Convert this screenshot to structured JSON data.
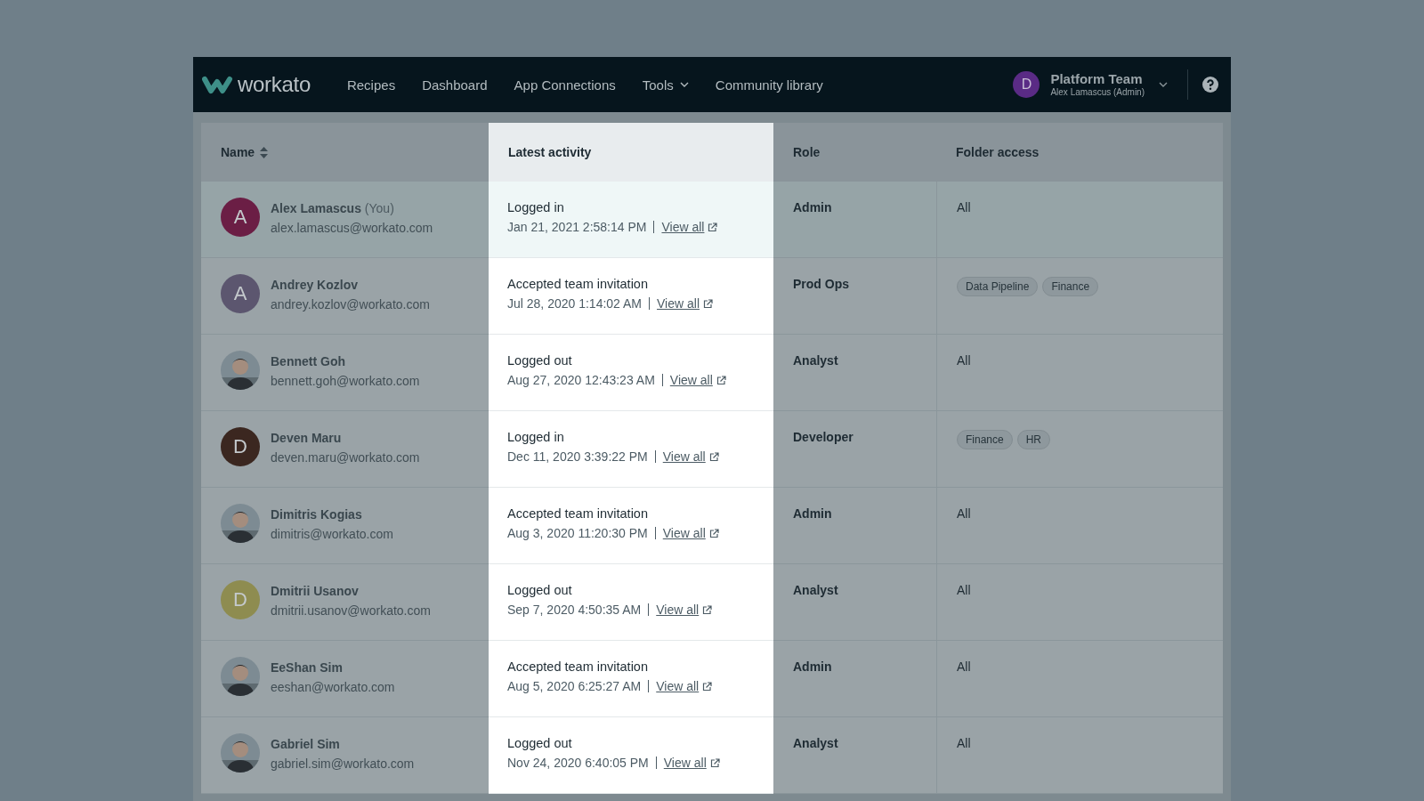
{
  "nav": {
    "logo": "workato",
    "items": [
      {
        "label": "Recipes",
        "dropdown": false
      },
      {
        "label": "Dashboard",
        "dropdown": false
      },
      {
        "label": "App Connections",
        "dropdown": false
      },
      {
        "label": "Tools",
        "dropdown": true
      },
      {
        "label": "Community library",
        "dropdown": false
      }
    ],
    "account": {
      "avatar": "D",
      "team": "Platform Team",
      "user": "Alex Lamascus (Admin)"
    }
  },
  "table": {
    "columns": [
      {
        "label": "Name",
        "sortable": true,
        "highlighted": false
      },
      {
        "label": "Latest activity",
        "sortable": false,
        "highlighted": true
      },
      {
        "label": "Role",
        "sortable": false,
        "highlighted": false
      },
      {
        "label": "Folder access",
        "sortable": false,
        "highlighted": false
      }
    ],
    "rows": [
      {
        "selected": true,
        "avatar": {
          "kind": "initial",
          "letter": "A",
          "color": "#6b1e45"
        },
        "name": "Alex Lamascus",
        "note": "(You)",
        "email": "alex.lamascus@workato.com",
        "activity": "Logged in",
        "time": "Jan 21, 2021 2:58:14 PM",
        "link": "View all",
        "role": "Admin",
        "folder_access": {
          "kind": "text",
          "labels": [
            "All"
          ]
        }
      },
      {
        "selected": false,
        "avatar": {
          "kind": "initial",
          "letter": "A",
          "color": "#5c566f"
        },
        "name": "Andrey Kozlov",
        "email": "andrey.kozlov@workato.com",
        "activity": "Accepted team invitation",
        "time": "Jul 28, 2020 1:14:02 AM",
        "link": "View all",
        "role": "Prod Ops",
        "folder_access": {
          "kind": "tags",
          "labels": [
            "Data Pipeline",
            "Finance"
          ]
        }
      },
      {
        "selected": false,
        "name": "Bennett Goh",
        "email": "bennett.goh@workato.com",
        "activity": "Logged out",
        "time": "Aug 27, 2020 12:43:23 AM",
        "link": "View all",
        "role": "Analyst",
        "folder_access": {
          "kind": "text",
          "labels": [
            "All"
          ]
        }
      },
      {
        "selected": false,
        "avatar": {
          "kind": "initial",
          "letter": "D",
          "color": "#3b2720"
        },
        "name": "Deven Maru",
        "email": "deven.maru@workato.com",
        "activity": "Logged in",
        "time": "Dec 11, 2020 3:39:22 PM",
        "link": "View all",
        "role": "Developer",
        "folder_access": {
          "kind": "tags",
          "labels": [
            "Finance",
            "HR"
          ]
        }
      },
      {
        "selected": false,
        "name": "Dimitris Kogias",
        "email": "dimitris@workato.com",
        "activity": "Accepted team invitation",
        "time": "Aug 3, 2020 11:20:30 PM",
        "link": "View all",
        "role": "Admin",
        "folder_access": {
          "kind": "text",
          "labels": [
            "All"
          ]
        }
      },
      {
        "selected": false,
        "avatar": {
          "kind": "initial",
          "letter": "D",
          "color": "#8e8c50"
        },
        "name": "Dmitrii Usanov",
        "email": "dmitrii.usanov@workato.com",
        "activity": "Logged out",
        "time": "Sep 7, 2020 4:50:35 AM",
        "link": "View all",
        "role": "Analyst",
        "folder_access": {
          "kind": "text",
          "labels": [
            "All"
          ]
        }
      },
      {
        "selected": false,
        "name": "EeShan Sim",
        "email": "eeshan@workato.com",
        "activity": "Accepted team invitation",
        "time": "Aug 5, 2020 6:25:27 AM",
        "link": "View all",
        "role": "Admin",
        "folder_access": {
          "kind": "text",
          "labels": [
            "All"
          ]
        }
      },
      {
        "selected": false,
        "name": "Gabriel Sim",
        "email": "gabriel.sim@workato.com",
        "activity": "Logged out",
        "time": "Nov 24, 2020 6:40:05 PM",
        "link": "View all",
        "role": "Analyst",
        "folder_access": {
          "kind": "text",
          "labels": [
            "All"
          ]
        }
      }
    ]
  }
}
